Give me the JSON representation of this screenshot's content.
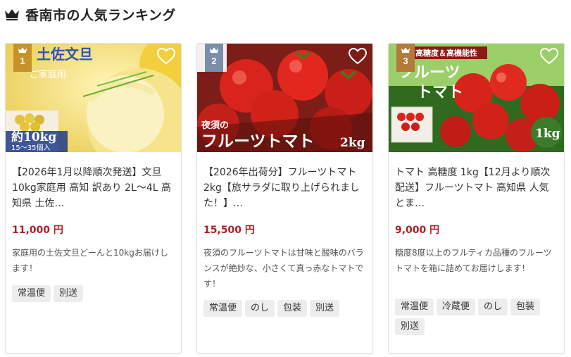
{
  "header": {
    "title": "香南市の人気ランキング",
    "icon": "crown-icon"
  },
  "colors": {
    "price": "#b01e22",
    "gold": "#c6922a",
    "silver": "#7b8ea8",
    "bronze": "#b37a3a"
  },
  "cards": [
    {
      "rank": "1",
      "image_text": {
        "line1": "土佐文旦",
        "line2": "ご家庭用",
        "weight": "約10kg",
        "count": "15〜35個入"
      },
      "name": "【2026年1月以降順次発送】文旦10kg家庭用 高知 訳あり 2L〜4L 高知県 土佐…",
      "price": "11,000 円",
      "description": "家庭用の土佐文旦どーんと10kgお届けします！",
      "tags": [
        "常温便",
        "別送"
      ]
    },
    {
      "rank": "2",
      "image_text": {
        "line1": "夜須の",
        "line2": "フルーツトマト",
        "weight": "2kg"
      },
      "name": "【2026年出荷分】フルーツトマト 2kg【旅サラダに取り上げられました！】…",
      "price": "15,500 円",
      "description": "夜須のフルーツトマトは甘味と酸味のバランスが絶妙な、小さくて真っ赤なトマトです！",
      "tags": [
        "常温便",
        "のし",
        "包装",
        "別送"
      ]
    },
    {
      "rank": "3",
      "image_text": {
        "line1": "高糖度＆高機能性",
        "line2": "フルーツ",
        "line3": "トマト",
        "weight": "1kg"
      },
      "name": "トマト 高糖度 1kg【12月より順次配送】フルーツトマト 高知県 人気 とま…",
      "price": "9,000 円",
      "description": "糖度8度以上のフルティカ品種のフルーツトマトを箱に詰めてお届けします！",
      "tags": [
        "常温便",
        "冷蔵便",
        "のし",
        "包装",
        "別送"
      ]
    }
  ]
}
